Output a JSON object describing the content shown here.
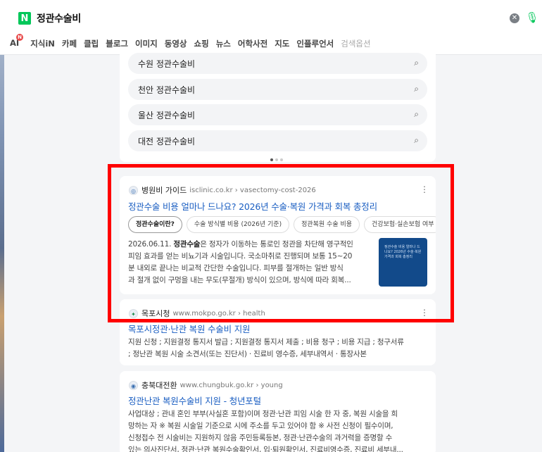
{
  "search": {
    "query": "정관수술비",
    "logo_text": "N"
  },
  "tabs": [
    "AI",
    "지식iN",
    "카페",
    "클립",
    "블로그",
    "이미지",
    "동영상",
    "쇼핑",
    "뉴스",
    "어학사전",
    "지도",
    "인플루언서",
    "검색옵션"
  ],
  "ai_badge": "N",
  "suggestions": [
    "수원 정관수술비",
    "천안 정관수술비",
    "울산 정관수술비",
    "대전 정관수술비"
  ],
  "result1": {
    "site": "병원비 가이드",
    "url": "isclinic.co.kr › vasectomy-cost-2026",
    "title": "정관수술 비용 얼마나 드나요? 2026년 수술·복원 가격과 회복 총정리",
    "chips": [
      "정관수술이란?",
      "수술 방식별 비용 (2026년 기준)",
      "정관복원 수술 비용",
      "건강보험·실손보험 여부"
    ],
    "date": "2026.06.11.",
    "desc_lines": [
      "정자가 이동하는 통로인 정관을 차단해 영구적인",
      "피임 효과를 얻는 비뇨기과 시술입니다. 국소마취로 진행되며 보통 15~20",
      "분 내외로 끝나는 비교적 간단한 수술입니다. 피부를 절개하는 일반 방식",
      "과 절개 없이 구멍을 내는 무도(무절개) 방식이 있으며, 방식에 따라 회복..."
    ],
    "desc_lead": "정관수술",
    "desc_lead_tail": "은",
    "thumb_text": "정관수술 비용 얼마나 드나요? 2026년 수술·복원 가격과 회복 총정리"
  },
  "result2": {
    "site": "목포시청",
    "url": "www.mokpo.go.kr › health",
    "title": "목포시정관·난관 복원 수술비 지원",
    "desc_lines": [
      "지원 신청 ; 지원결정 통지서 발급 ; 지원결정 통지서 제출 ; 비용 청구 ; 비용 지급 ; 청구서류",
      "; 정난관 복원 시술 소견서(또는 진단서) · 진료비 영수증, 세부내역서 · 통장사본"
    ]
  },
  "result3": {
    "site": "충북대전환",
    "url": "www.chungbuk.go.kr › young",
    "title": "정관난관 복원수술비 지원 - 청년포털",
    "desc_lines": [
      "사업대상 ; 관내 혼인 부부(사실혼 포함)이며 정관·난관 피임 시술 한 자 중, 복원 시술을 희",
      "망하는 자 ※ 복원 시술일 기준으로 시에 주소를 두고 있어야 함 ※ 사전 신청이 필수이며,",
      "신청접수 전 시술비는 지원하지 않음 주민등록등본, 정관·난관수술의 과거력을 증명할 수",
      "있는 의사진단서, 정관·난관 복원수술확인서, 입·퇴원확인서, 진료비영수증, 진료비 세부내..."
    ]
  },
  "colors": {
    "naver_green": "#03c75a",
    "link_blue": "#1a5ec2",
    "highlight_red": "#ff0000"
  }
}
